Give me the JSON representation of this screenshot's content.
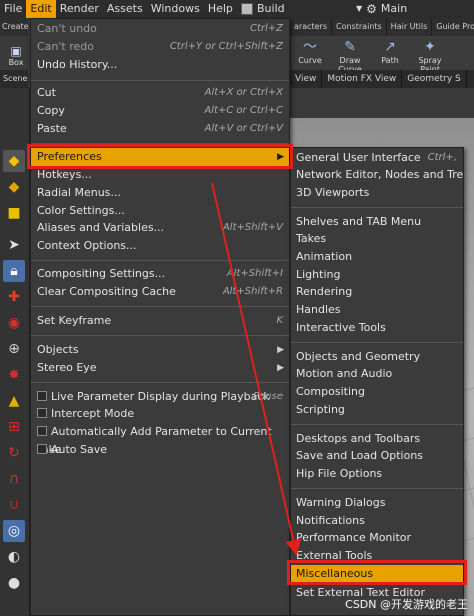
{
  "menubar": {
    "items": [
      "File",
      "Edit",
      "Render",
      "Assets",
      "Windows",
      "Help"
    ],
    "build_label": "Build",
    "main_label": "Main"
  },
  "left_top": {
    "tab": "Create",
    "tool": "Box",
    "scene": "Scene"
  },
  "shelf": {
    "tabs": [
      "aracters",
      "Constraints",
      "Hair Utils",
      "Guide Proce"
    ],
    "tools": [
      {
        "label": "Curve",
        "icon": "curve-icon"
      },
      {
        "label": "Draw Curve",
        "icon": "draw-curve-icon"
      },
      {
        "label": "Path",
        "icon": "path-icon"
      },
      {
        "label": "Spray Paint",
        "icon": "spray-paint-icon"
      }
    ],
    "view_tabs": [
      "View",
      "Motion FX View",
      "Geometry S"
    ]
  },
  "edit_menu": {
    "items": [
      {
        "label": "Can't undo",
        "shortcut": "Ctrl+Z",
        "disabled": true
      },
      {
        "label": "Can't redo",
        "shortcut": "Ctrl+Y or Ctrl+Shift+Z",
        "disabled": true
      },
      {
        "label": "Undo History...",
        "shortcut": ""
      },
      {
        "label": "Cut",
        "shortcut": "Alt+X or Ctrl+X"
      },
      {
        "label": "Copy",
        "shortcut": "Alt+C or Ctrl+C"
      },
      {
        "label": "Paste",
        "shortcut": "Alt+V or Ctrl+V"
      },
      {
        "label": "Preferences",
        "shortcut": "",
        "submenu": true,
        "selected": true
      },
      {
        "label": "Hotkeys...",
        "shortcut": ""
      },
      {
        "label": "Radial Menus...",
        "shortcut": ""
      },
      {
        "label": "Color Settings...",
        "shortcut": ""
      },
      {
        "label": "Aliases and Variables...",
        "shortcut": "Alt+Shift+V"
      },
      {
        "label": "Context Options...",
        "shortcut": ""
      },
      {
        "label": "Compositing Settings...",
        "shortcut": "Alt+Shift+I"
      },
      {
        "label": "Clear Compositing Cache",
        "shortcut": "Alt+Shift+R"
      },
      {
        "label": "Set Keyframe",
        "shortcut": "K"
      },
      {
        "label": "Objects",
        "shortcut": "",
        "submenu": true
      },
      {
        "label": "Stereo Eye",
        "shortcut": "",
        "submenu": true
      },
      {
        "label": "Live Parameter Display during Playback",
        "shortcut": "Pause",
        "checkbox": true
      },
      {
        "label": "Intercept Mode",
        "shortcut": "",
        "checkbox": true
      },
      {
        "label": "Automatically Add Parameter to Current Take",
        "shortcut": "",
        "checkbox": true
      },
      {
        "label": "Auto Save",
        "shortcut": "",
        "checkbox": true
      }
    ]
  },
  "preferences_menu": {
    "items": [
      {
        "label": "General User Interface",
        "shortcut": "Ctrl+,"
      },
      {
        "label": "Network Editor, Nodes and Trees",
        "shortcut": ""
      },
      {
        "label": "3D Viewports",
        "shortcut": ""
      },
      {
        "label": "Shelves and TAB Menu",
        "shortcut": ""
      },
      {
        "label": "Takes",
        "shortcut": ""
      },
      {
        "label": "Animation",
        "shortcut": ""
      },
      {
        "label": "Lighting",
        "shortcut": ""
      },
      {
        "label": "Rendering",
        "shortcut": ""
      },
      {
        "label": "Handles",
        "shortcut": ""
      },
      {
        "label": "Interactive Tools",
        "shortcut": ""
      },
      {
        "label": "Objects and Geometry",
        "shortcut": ""
      },
      {
        "label": "Motion and Audio",
        "shortcut": ""
      },
      {
        "label": "Compositing",
        "shortcut": ""
      },
      {
        "label": "Scripting",
        "shortcut": ""
      },
      {
        "label": "Desktops and Toolbars",
        "shortcut": ""
      },
      {
        "label": "Save and Load Options",
        "shortcut": ""
      },
      {
        "label": "Hip File Options",
        "shortcut": ""
      },
      {
        "label": "Warning Dialogs",
        "shortcut": ""
      },
      {
        "label": "Notifications",
        "shortcut": ""
      },
      {
        "label": "Performance Monitor",
        "shortcut": ""
      },
      {
        "label": "External Tools",
        "shortcut": ""
      },
      {
        "label": "Miscellaneous",
        "shortcut": "",
        "selected": true
      },
      {
        "label": "Set External Text Editor",
        "shortcut": ""
      }
    ]
  },
  "watermark": "CSDN @开发游戏的老王",
  "colors": {
    "highlight": "#e8a200",
    "annotation": "#e0201a",
    "menu_bg": "#3b3b3b"
  }
}
